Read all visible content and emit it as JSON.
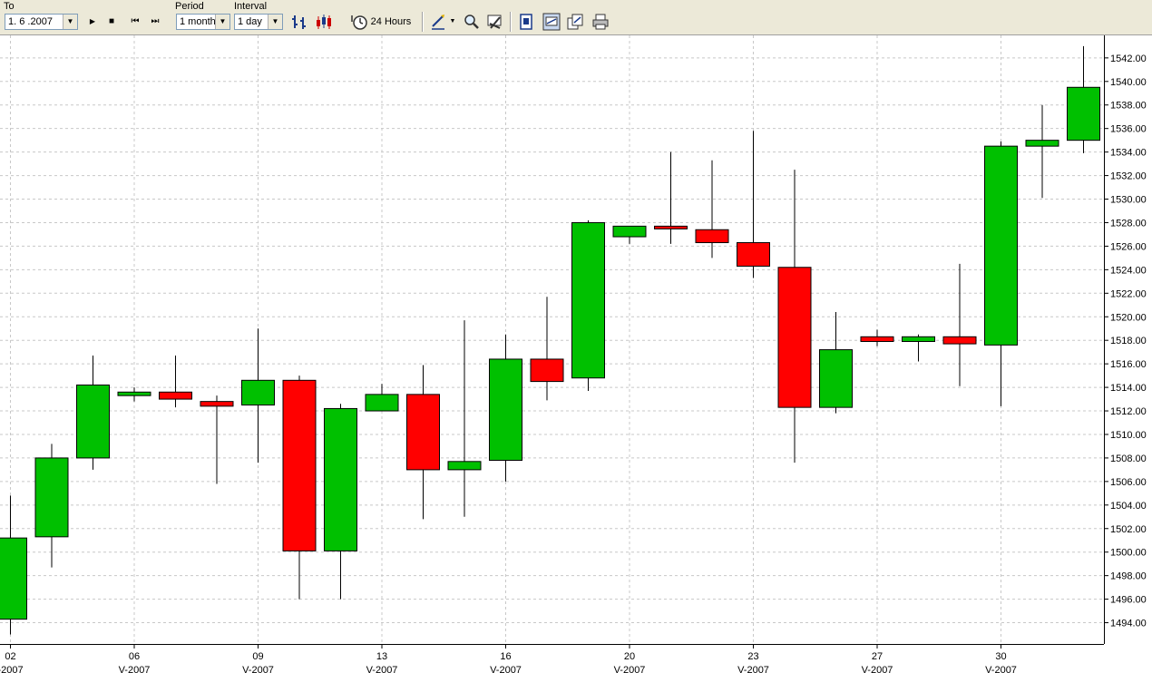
{
  "toolbar": {
    "to_label": "To",
    "to_value": "1. 6 .2007",
    "period_label": "Period",
    "period_value": "1 month",
    "interval_label": "Interval",
    "interval_value": "1 day",
    "hours_label": "24 Hours",
    "play_glyph": "▶",
    "stop_glyph": "■",
    "prev_glyph": "⏮",
    "next_glyph": "⏭",
    "dropdown_glyph": "▼",
    "icons": [
      "play-icon",
      "stop-icon",
      "skip-back-icon",
      "skip-forward-icon",
      "bar-chart-icon",
      "candle-chart-icon",
      "clock-icon",
      "draw-tool-icon",
      "zoom-icon",
      "settings-icon",
      "export-icon",
      "chart-window-icon",
      "copy-icon",
      "print-icon"
    ]
  },
  "colors": {
    "up": "#00c000",
    "down": "#ff0000",
    "grid": "#c8c8c8",
    "toolbar_bg": "#ece9d8"
  },
  "chart_data": {
    "type": "candlestick",
    "title": "",
    "y_ticks": [
      "1494.00",
      "1496.00",
      "1498.00",
      "1500.00",
      "1502.00",
      "1504.00",
      "1506.00",
      "1508.00",
      "1510.00",
      "1512.00",
      "1514.00",
      "1516.00",
      "1518.00",
      "1520.00",
      "1522.00",
      "1524.00",
      "1526.00",
      "1528.00",
      "1530.00",
      "1532.00",
      "1534.00",
      "1536.00",
      "1538.00",
      "1540.00",
      "1542.00"
    ],
    "ylim": [
      1492.5,
      1543.8
    ],
    "x_ticks": [
      {
        "day": "02",
        "month": "-2007"
      },
      {
        "day": "06",
        "month": "V-2007"
      },
      {
        "day": "09",
        "month": "V-2007"
      },
      {
        "day": "13",
        "month": "V-2007"
      },
      {
        "day": "16",
        "month": "V-2007"
      },
      {
        "day": "20",
        "month": "V-2007"
      },
      {
        "day": "23",
        "month": "V-2007"
      },
      {
        "day": "27",
        "month": "V-2007"
      },
      {
        "day": "30",
        "month": "V-2007"
      }
    ],
    "candles": [
      {
        "o": 1494.3,
        "h": 1504.8,
        "l": 1493.0,
        "c": 1501.2
      },
      {
        "o": 1501.3,
        "h": 1509.2,
        "l": 1498.7,
        "c": 1508.0
      },
      {
        "o": 1508.0,
        "h": 1516.7,
        "l": 1507.0,
        "c": 1514.2
      },
      {
        "o": 1513.3,
        "h": 1514.0,
        "l": 1512.8,
        "c": 1513.6
      },
      {
        "o": 1513.6,
        "h": 1516.7,
        "l": 1512.3,
        "c": 1513.0
      },
      {
        "o": 1512.8,
        "h": 1513.3,
        "l": 1505.8,
        "c": 1512.4
      },
      {
        "o": 1512.5,
        "h": 1519.0,
        "l": 1507.6,
        "c": 1514.6
      },
      {
        "o": 1514.6,
        "h": 1515.0,
        "l": 1496.0,
        "c": 1500.1
      },
      {
        "o": 1500.1,
        "h": 1512.6,
        "l": 1496.0,
        "c": 1512.2
      },
      {
        "o": 1512.0,
        "h": 1514.3,
        "l": 1512.0,
        "c": 1513.4
      },
      {
        "o": 1513.4,
        "h": 1515.9,
        "l": 1502.8,
        "c": 1507.0
      },
      {
        "o": 1507.0,
        "h": 1519.7,
        "l": 1503.0,
        "c": 1507.7
      },
      {
        "o": 1507.8,
        "h": 1518.5,
        "l": 1506.0,
        "c": 1516.4
      },
      {
        "o": 1516.4,
        "h": 1521.7,
        "l": 1512.9,
        "c": 1514.5
      },
      {
        "o": 1514.8,
        "h": 1528.2,
        "l": 1513.7,
        "c": 1528.0
      },
      {
        "o": 1526.8,
        "h": 1527.7,
        "l": 1526.2,
        "c": 1527.7
      },
      {
        "o": 1527.7,
        "h": 1534.0,
        "l": 1526.2,
        "c": 1527.5
      },
      {
        "o": 1527.4,
        "h": 1533.3,
        "l": 1525.0,
        "c": 1526.3
      },
      {
        "o": 1526.3,
        "h": 1535.8,
        "l": 1523.3,
        "c": 1524.3
      },
      {
        "o": 1524.2,
        "h": 1532.5,
        "l": 1507.6,
        "c": 1512.3
      },
      {
        "o": 1512.3,
        "h": 1520.4,
        "l": 1511.8,
        "c": 1517.2
      },
      {
        "o": 1518.3,
        "h": 1518.9,
        "l": 1517.5,
        "c": 1517.9
      },
      {
        "o": 1517.9,
        "h": 1518.5,
        "l": 1516.2,
        "c": 1518.3
      },
      {
        "o": 1518.3,
        "h": 1524.5,
        "l": 1514.1,
        "c": 1517.7
      },
      {
        "o": 1517.6,
        "h": 1534.9,
        "l": 1512.4,
        "c": 1534.5
      },
      {
        "o": 1534.5,
        "h": 1538.0,
        "l": 1530.1,
        "c": 1535.0
      },
      {
        "o": 1535.0,
        "h": 1543.0,
        "l": 1533.9,
        "c": 1539.5
      }
    ]
  }
}
